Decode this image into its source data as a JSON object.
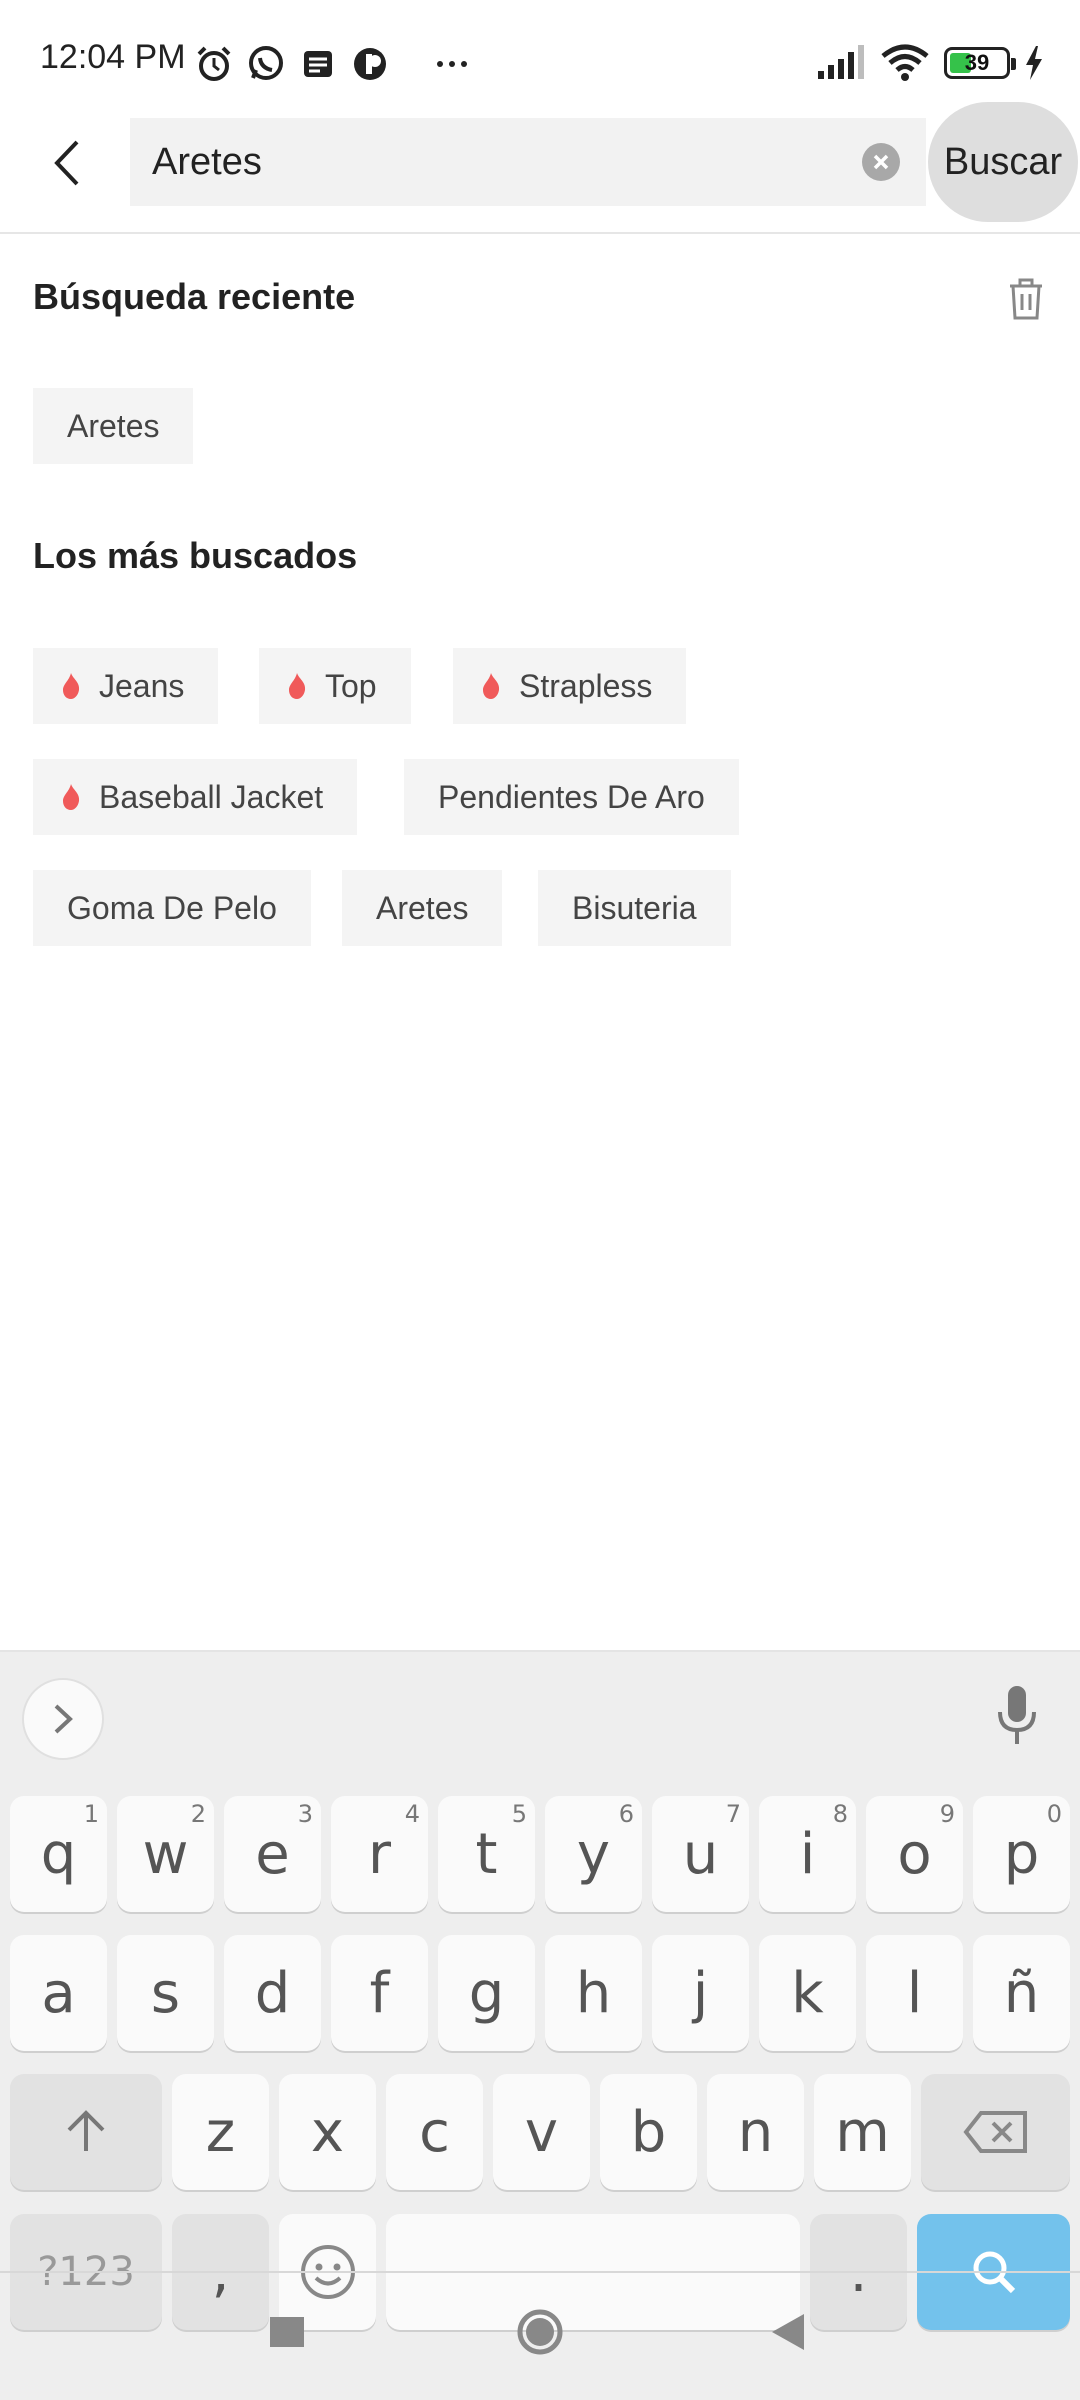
{
  "status_bar": {
    "time": "12:04 PM",
    "battery_level": "39",
    "battery_fraction": 0.39,
    "left_icons": [
      "alarm-icon",
      "whatsapp-icon",
      "message-icon",
      "app-icon",
      "more-dots-icon"
    ],
    "right_icons": [
      "signal-icon",
      "wifi-icon",
      "battery-icon",
      "charging-icon"
    ]
  },
  "search": {
    "value": "Aretes",
    "submit_label": "Buscar"
  },
  "recent": {
    "title": "Búsqueda reciente",
    "items": [
      "Aretes"
    ]
  },
  "popular": {
    "title": "Los más buscados",
    "items": [
      {
        "label": "Jeans",
        "hot": true
      },
      {
        "label": "Top",
        "hot": true
      },
      {
        "label": "Strapless",
        "hot": true
      },
      {
        "label": "Baseball Jacket",
        "hot": true
      },
      {
        "label": "Pendientes De Aro",
        "hot": false
      },
      {
        "label": "Goma De Pelo",
        "hot": false
      },
      {
        "label": "Aretes",
        "hot": false
      },
      {
        "label": "Bisuteria",
        "hot": false
      }
    ]
  },
  "keyboard": {
    "row1": [
      {
        "char": "q",
        "num": "1"
      },
      {
        "char": "w",
        "num": "2"
      },
      {
        "char": "e",
        "num": "3"
      },
      {
        "char": "r",
        "num": "4"
      },
      {
        "char": "t",
        "num": "5"
      },
      {
        "char": "y",
        "num": "6"
      },
      {
        "char": "u",
        "num": "7"
      },
      {
        "char": "i",
        "num": "8"
      },
      {
        "char": "o",
        "num": "9"
      },
      {
        "char": "p",
        "num": "0"
      }
    ],
    "row2": [
      "a",
      "s",
      "d",
      "f",
      "g",
      "h",
      "j",
      "k",
      "l",
      "ñ"
    ],
    "row3": [
      "z",
      "x",
      "c",
      "v",
      "b",
      "n",
      "m"
    ],
    "symbols_label": "?123",
    "comma": ",",
    "period": "."
  },
  "colors": {
    "flame": "#f05a5a",
    "accent_key": "#73c2ec",
    "battery_fill": "#35c24a"
  }
}
